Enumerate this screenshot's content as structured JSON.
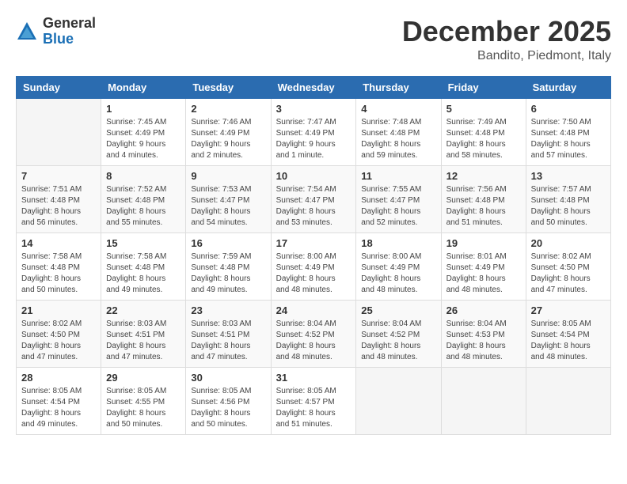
{
  "logo": {
    "general": "General",
    "blue": "Blue"
  },
  "header": {
    "month": "December 2025",
    "location": "Bandito, Piedmont, Italy"
  },
  "weekdays": [
    "Sunday",
    "Monday",
    "Tuesday",
    "Wednesday",
    "Thursday",
    "Friday",
    "Saturday"
  ],
  "weeks": [
    [
      {
        "day": "",
        "info": ""
      },
      {
        "day": "1",
        "info": "Sunrise: 7:45 AM\nSunset: 4:49 PM\nDaylight: 9 hours\nand 4 minutes."
      },
      {
        "day": "2",
        "info": "Sunrise: 7:46 AM\nSunset: 4:49 PM\nDaylight: 9 hours\nand 2 minutes."
      },
      {
        "day": "3",
        "info": "Sunrise: 7:47 AM\nSunset: 4:49 PM\nDaylight: 9 hours\nand 1 minute."
      },
      {
        "day": "4",
        "info": "Sunrise: 7:48 AM\nSunset: 4:48 PM\nDaylight: 8 hours\nand 59 minutes."
      },
      {
        "day": "5",
        "info": "Sunrise: 7:49 AM\nSunset: 4:48 PM\nDaylight: 8 hours\nand 58 minutes."
      },
      {
        "day": "6",
        "info": "Sunrise: 7:50 AM\nSunset: 4:48 PM\nDaylight: 8 hours\nand 57 minutes."
      }
    ],
    [
      {
        "day": "7",
        "info": "Sunrise: 7:51 AM\nSunset: 4:48 PM\nDaylight: 8 hours\nand 56 minutes."
      },
      {
        "day": "8",
        "info": "Sunrise: 7:52 AM\nSunset: 4:48 PM\nDaylight: 8 hours\nand 55 minutes."
      },
      {
        "day": "9",
        "info": "Sunrise: 7:53 AM\nSunset: 4:47 PM\nDaylight: 8 hours\nand 54 minutes."
      },
      {
        "day": "10",
        "info": "Sunrise: 7:54 AM\nSunset: 4:47 PM\nDaylight: 8 hours\nand 53 minutes."
      },
      {
        "day": "11",
        "info": "Sunrise: 7:55 AM\nSunset: 4:47 PM\nDaylight: 8 hours\nand 52 minutes."
      },
      {
        "day": "12",
        "info": "Sunrise: 7:56 AM\nSunset: 4:48 PM\nDaylight: 8 hours\nand 51 minutes."
      },
      {
        "day": "13",
        "info": "Sunrise: 7:57 AM\nSunset: 4:48 PM\nDaylight: 8 hours\nand 50 minutes."
      }
    ],
    [
      {
        "day": "14",
        "info": "Sunrise: 7:58 AM\nSunset: 4:48 PM\nDaylight: 8 hours\nand 50 minutes."
      },
      {
        "day": "15",
        "info": "Sunrise: 7:58 AM\nSunset: 4:48 PM\nDaylight: 8 hours\nand 49 minutes."
      },
      {
        "day": "16",
        "info": "Sunrise: 7:59 AM\nSunset: 4:48 PM\nDaylight: 8 hours\nand 49 minutes."
      },
      {
        "day": "17",
        "info": "Sunrise: 8:00 AM\nSunset: 4:49 PM\nDaylight: 8 hours\nand 48 minutes."
      },
      {
        "day": "18",
        "info": "Sunrise: 8:00 AM\nSunset: 4:49 PM\nDaylight: 8 hours\nand 48 minutes."
      },
      {
        "day": "19",
        "info": "Sunrise: 8:01 AM\nSunset: 4:49 PM\nDaylight: 8 hours\nand 48 minutes."
      },
      {
        "day": "20",
        "info": "Sunrise: 8:02 AM\nSunset: 4:50 PM\nDaylight: 8 hours\nand 47 minutes."
      }
    ],
    [
      {
        "day": "21",
        "info": "Sunrise: 8:02 AM\nSunset: 4:50 PM\nDaylight: 8 hours\nand 47 minutes."
      },
      {
        "day": "22",
        "info": "Sunrise: 8:03 AM\nSunset: 4:51 PM\nDaylight: 8 hours\nand 47 minutes."
      },
      {
        "day": "23",
        "info": "Sunrise: 8:03 AM\nSunset: 4:51 PM\nDaylight: 8 hours\nand 47 minutes."
      },
      {
        "day": "24",
        "info": "Sunrise: 8:04 AM\nSunset: 4:52 PM\nDaylight: 8 hours\nand 48 minutes."
      },
      {
        "day": "25",
        "info": "Sunrise: 8:04 AM\nSunset: 4:52 PM\nDaylight: 8 hours\nand 48 minutes."
      },
      {
        "day": "26",
        "info": "Sunrise: 8:04 AM\nSunset: 4:53 PM\nDaylight: 8 hours\nand 48 minutes."
      },
      {
        "day": "27",
        "info": "Sunrise: 8:05 AM\nSunset: 4:54 PM\nDaylight: 8 hours\nand 48 minutes."
      }
    ],
    [
      {
        "day": "28",
        "info": "Sunrise: 8:05 AM\nSunset: 4:54 PM\nDaylight: 8 hours\nand 49 minutes."
      },
      {
        "day": "29",
        "info": "Sunrise: 8:05 AM\nSunset: 4:55 PM\nDaylight: 8 hours\nand 50 minutes."
      },
      {
        "day": "30",
        "info": "Sunrise: 8:05 AM\nSunset: 4:56 PM\nDaylight: 8 hours\nand 50 minutes."
      },
      {
        "day": "31",
        "info": "Sunrise: 8:05 AM\nSunset: 4:57 PM\nDaylight: 8 hours\nand 51 minutes."
      },
      {
        "day": "",
        "info": ""
      },
      {
        "day": "",
        "info": ""
      },
      {
        "day": "",
        "info": ""
      }
    ]
  ]
}
